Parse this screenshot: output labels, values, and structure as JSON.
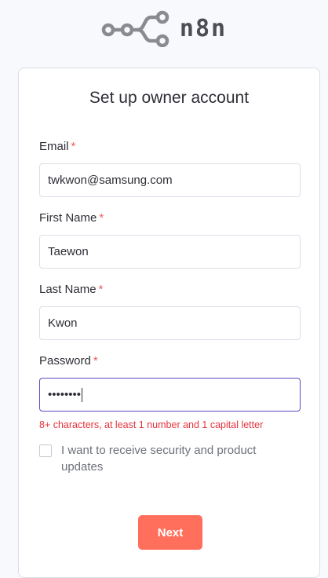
{
  "brand": {
    "name": "n8n"
  },
  "form": {
    "title": "Set up owner account",
    "fields": [
      {
        "label": "Email",
        "required_mark": "*",
        "value": "twkwon@samsung.com"
      },
      {
        "label": "First Name",
        "required_mark": "*",
        "value": "Taewon"
      },
      {
        "label": "Last Name",
        "required_mark": "*",
        "value": "Kwon"
      },
      {
        "label": "Password",
        "required_mark": "*",
        "value": "••••••••",
        "hint": "8+ characters, at least 1 number and 1 capital letter"
      }
    ],
    "checkbox_label": "I want to receive security and product updates",
    "checkbox_checked": false,
    "submit_label": "Next"
  },
  "colors": {
    "accent": "#ff6f5c",
    "required": "#f45959",
    "error": "#e3343c",
    "focus_border": "#5b4bc4",
    "logo": "#4d4e54"
  },
  "icons": {
    "logo": "n8n-logo-icon"
  }
}
